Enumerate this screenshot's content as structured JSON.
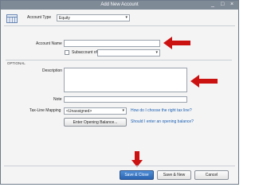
{
  "window": {
    "title": "Add New Account",
    "minimize": "_",
    "maximize": "□",
    "close": "×"
  },
  "account_type": {
    "label": "Account Type",
    "value": "Equity"
  },
  "account_name": {
    "label": "Account Name",
    "value": ""
  },
  "subaccount": {
    "label": "Subaccount of",
    "checked": false,
    "value": ""
  },
  "optional": {
    "header": "OPTIONAL",
    "description_label": "Description",
    "description_value": "",
    "note_label": "Note",
    "note_value": "",
    "tax_line_label": "Tax-Line Mapping",
    "tax_line_value": "<Unassigned>",
    "tax_help_link": "How do I choose the right tax line?",
    "opening_balance_button": "Enter Opening Balance...",
    "opening_balance_link": "Should I enter an opening balance?"
  },
  "footer": {
    "save_close": "Save & Close",
    "save_new": "Save & New",
    "cancel": "Cancel"
  },
  "colors": {
    "annotation_arrow": "#cc1111",
    "primary_button": "#2a63b0"
  }
}
